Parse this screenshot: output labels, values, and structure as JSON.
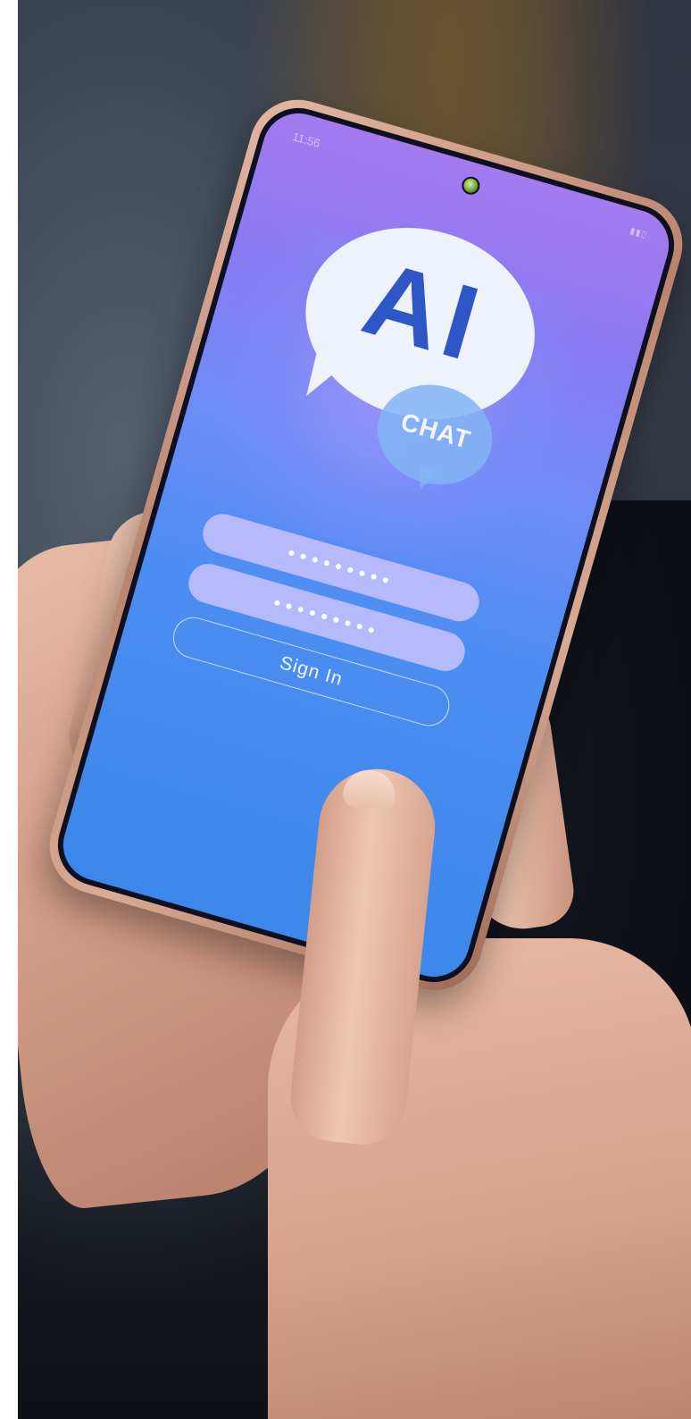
{
  "phone_screen": {
    "status_time": "11:56",
    "logo_main_text": "AI",
    "logo_sub_text": "CHAT",
    "username_field_value": "•••••••••",
    "password_field_value": "•••••••••",
    "signin_label": "Sign In"
  },
  "colors": {
    "logo_text": "#2f56c6",
    "screen_top": "#a47af0",
    "screen_bottom": "#3c87ea",
    "field_fill": "#cdc3ff"
  }
}
